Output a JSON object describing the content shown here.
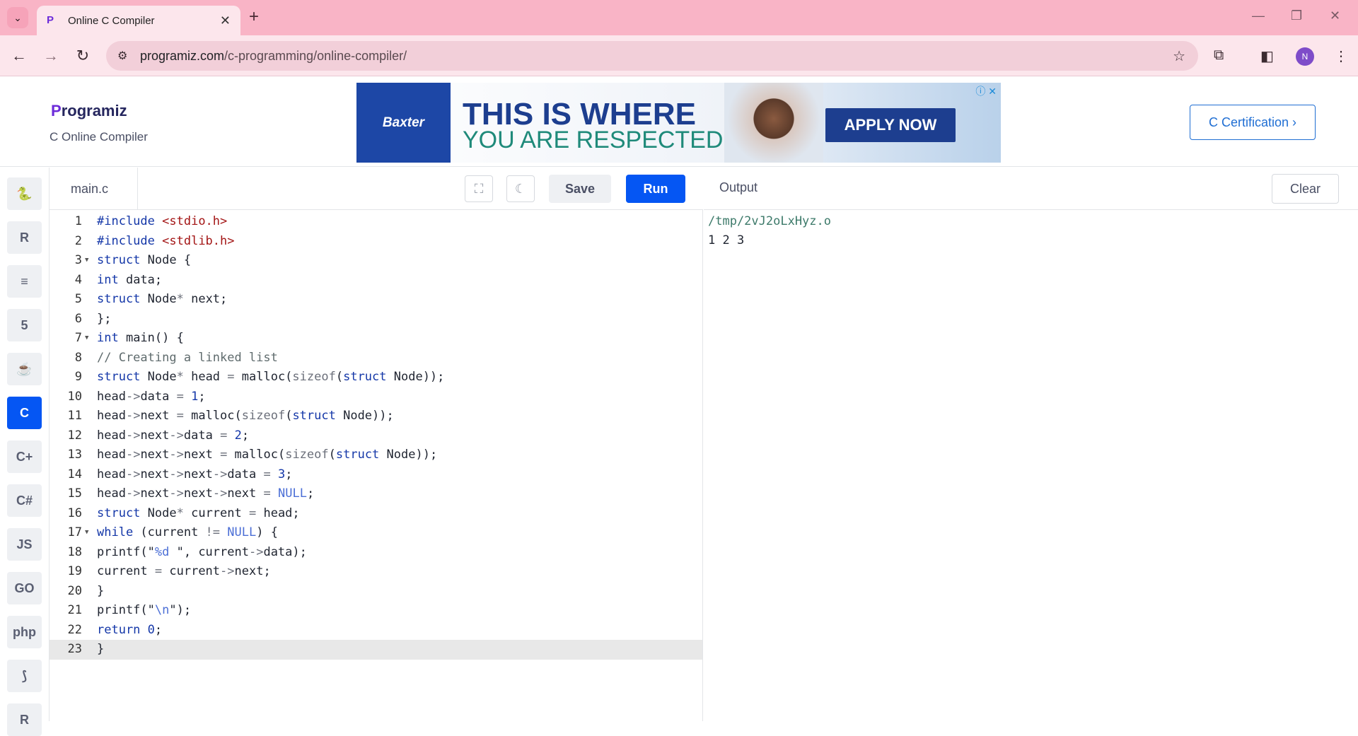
{
  "browser": {
    "tab_title": "Online C Compiler",
    "url_host": "programiz.com",
    "url_path": "/c-programming/online-compiler/",
    "avatar_letter": "N"
  },
  "header": {
    "logo_text": "rogramiz",
    "logo_letter": "P",
    "subtitle": "C Online Compiler",
    "cert_button": "C Certification ›"
  },
  "ad": {
    "brand": "Baxter",
    "line1": "THIS IS WHERE",
    "line2": "YOU ARE RESPECTED",
    "cta": "APPLY NOW"
  },
  "sidebar": {
    "languages": [
      {
        "name": "python",
        "label": "🐍"
      },
      {
        "name": "r",
        "label": "R"
      },
      {
        "name": "sql",
        "label": "≡"
      },
      {
        "name": "html",
        "label": "5"
      },
      {
        "name": "java",
        "label": "☕"
      },
      {
        "name": "c",
        "label": "C",
        "active": true
      },
      {
        "name": "cpp",
        "label": "C+"
      },
      {
        "name": "csharp",
        "label": "C#"
      },
      {
        "name": "js",
        "label": "JS"
      },
      {
        "name": "go",
        "label": "GO"
      },
      {
        "name": "php",
        "label": "php"
      },
      {
        "name": "swift",
        "label": "⟆"
      },
      {
        "name": "rust",
        "label": "R"
      }
    ]
  },
  "editor": {
    "file_name": "main.c",
    "save_label": "Save",
    "run_label": "Run",
    "current_line": 23,
    "lines": [
      "<span class='kw'>#include</span> <span class='str'>&lt;stdio.h&gt;</span>",
      "<span class='kw'>#include</span> <span class='str'>&lt;stdlib.h&gt;</span>",
      "<span class='kw'>struct</span> Node {",
      "<span class='kw'>int</span> data;",
      "<span class='kw'>struct</span> Node<span class='op'>*</span> next;",
      "};",
      "<span class='kw'>int</span> main() {",
      "<span class='cm'>// Creating a linked list</span>",
      "<span class='kw'>struct</span> Node<span class='op'>*</span> head <span class='op'>=</span> malloc(<span class='op'>sizeof</span>(<span class='kw'>struct</span> Node));",
      "head<span class='op'>-&gt;</span>data <span class='op'>=</span> <span class='num'>1</span>;",
      "head<span class='op'>-&gt;</span>next <span class='op'>=</span> malloc(<span class='op'>sizeof</span>(<span class='kw'>struct</span> Node));",
      "head<span class='op'>-&gt;</span>next<span class='op'>-&gt;</span>data <span class='op'>=</span> <span class='num'>2</span>;",
      "head<span class='op'>-&gt;</span>next<span class='op'>-&gt;</span>next <span class='op'>=</span> malloc(<span class='op'>sizeof</span>(<span class='kw'>struct</span> Node));",
      "head<span class='op'>-&gt;</span>next<span class='op'>-&gt;</span>next<span class='op'>-&gt;</span>data <span class='op'>=</span> <span class='num'>3</span>;",
      "head<span class='op'>-&gt;</span>next<span class='op'>-&gt;</span>next<span class='op'>-&gt;</span>next <span class='op'>=</span> <span class='cst'>NULL</span>;",
      "<span class='kw'>struct</span> Node<span class='op'>*</span> current <span class='op'>=</span> head;",
      "<span class='kw'>while</span> (current <span class='op'>!=</span> <span class='cst'>NULL</span>) {",
      "printf(\"<span class='cst'>%d</span> \", current<span class='op'>-&gt;</span>data);",
      "current <span class='op'>=</span> current<span class='op'>-&gt;</span>next;",
      "}",
      "printf(\"<span class='cst'>\\n</span>\");",
      "<span class='kw'>return</span> <span class='num'>0</span>;",
      "}"
    ],
    "fold_lines": [
      3,
      7,
      17
    ]
  },
  "output": {
    "label": "Output",
    "clear_label": "Clear",
    "path": "/tmp/2vJ2oLxHyz.o",
    "result": "1 2 3"
  }
}
